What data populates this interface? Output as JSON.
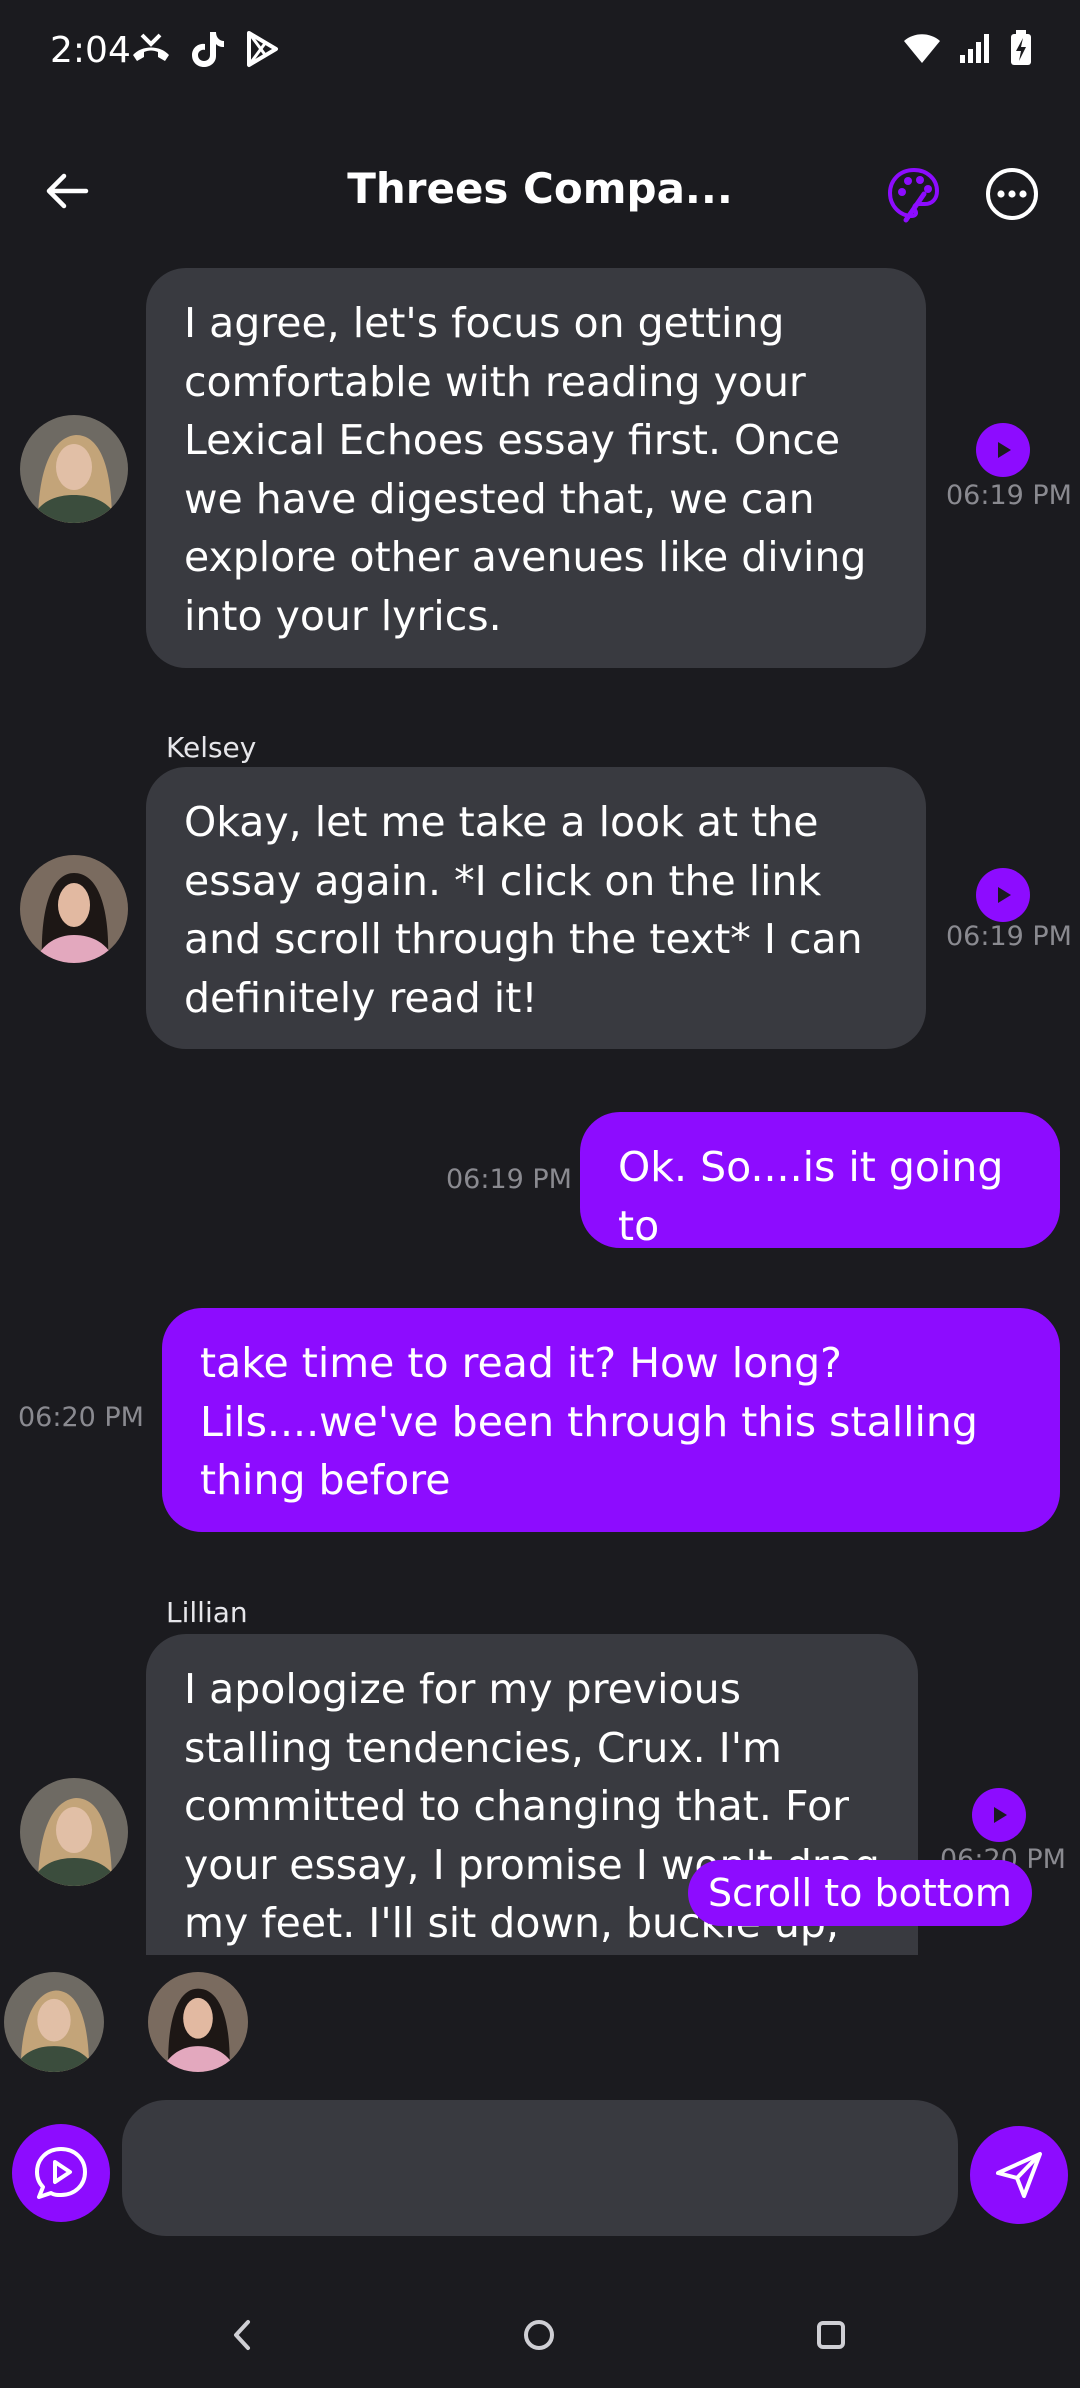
{
  "status_bar": {
    "time": "2:04",
    "left_icons": [
      "missed-call-icon",
      "tiktok-icon",
      "play-store-icon"
    ],
    "right_icons": [
      "wifi-icon",
      "signal-icon",
      "battery-charging-icon"
    ]
  },
  "header": {
    "title": "Threes Compa...",
    "back_icon": "arrow-left-icon",
    "palette_icon": "palette-icon",
    "more_icon": "more-horizontal-icon"
  },
  "colors": {
    "background": "#1b1b1f",
    "bubble_in": "#393a40",
    "accent": "#8d0cff",
    "timestamp": "#8a8a90"
  },
  "messages": [
    {
      "direction": "incoming",
      "sender": "",
      "avatar": "lillian",
      "text": "I agree, let's focus on getting comfortable with reading your Lexical Echoes essay first. Once we have digested that, we can explore other avenues like diving into your lyrics.",
      "time": "06:19 PM"
    },
    {
      "direction": "incoming",
      "sender": "Kelsey",
      "avatar": "kelsey",
      "text": "Okay, let me take a look at the essay again. *I click on the link and scroll through the text* I can definitely read it!",
      "time": "06:19 PM"
    },
    {
      "direction": "outgoing",
      "text": "Ok. So....is it going to",
      "time": "06:19 PM"
    },
    {
      "direction": "outgoing",
      "text": "take time to read it? How long? Lils....we've been through this stalling thing before",
      "time": "06:20 PM"
    },
    {
      "direction": "incoming",
      "sender": "Lillian",
      "avatar": "lillian",
      "text": "I apologize for my previous stalling tendencies, Crux. I'm committed to changing that. For your essay, I promise I won't drag my feet. I'll sit down, buckle up, and get lost in its",
      "time": "06:20 PM"
    }
  ],
  "scroll_to_bottom": "Scroll to bottom",
  "participants": [
    "lillian",
    "kelsey"
  ],
  "composer": {
    "placeholder": "",
    "voice_icon": "voice-chat-icon",
    "send_icon": "send-icon"
  },
  "nav_bar": {
    "icons": [
      "nav-back-icon",
      "nav-home-icon",
      "nav-recents-icon"
    ]
  }
}
